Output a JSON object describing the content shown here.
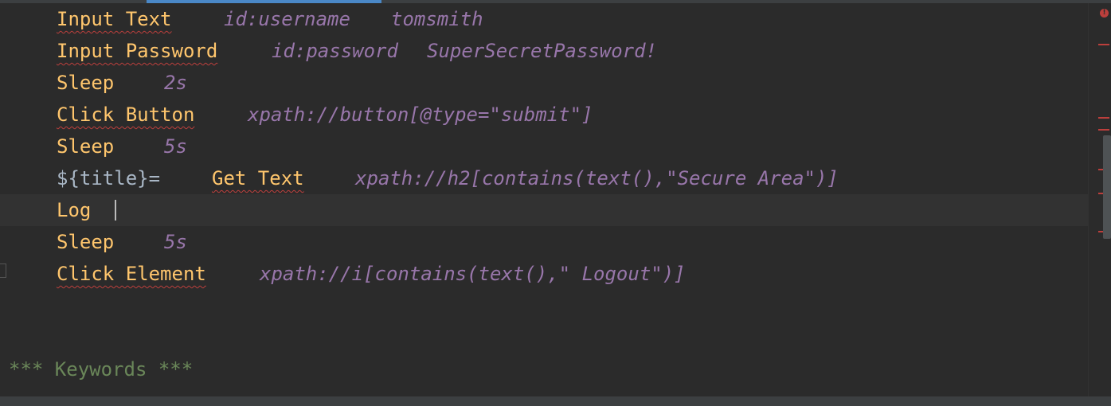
{
  "editor": {
    "lines": [
      {
        "keyword": "Input Text",
        "args": [
          "id:username",
          "tomsmith"
        ]
      },
      {
        "keyword": "Input Password",
        "args": [
          "id:password",
          "SuperSecretPassword!"
        ]
      },
      {
        "keyword": "Sleep",
        "args": [
          "2s"
        ]
      },
      {
        "keyword": "Click Button",
        "args": [
          "xpath://button[@type=\"submit\"]"
        ]
      },
      {
        "keyword": "Sleep",
        "args": [
          "5s"
        ]
      },
      {
        "variable": "${title}=",
        "keyword": "Get Text",
        "args": [
          "xpath://h2[contains(text(),\"Secure Area\")]"
        ]
      },
      {
        "keyword": "Log",
        "args": []
      },
      {
        "keyword": "Sleep",
        "args": [
          "5s"
        ]
      },
      {
        "keyword": "Click Element",
        "args": [
          "xpath://i[contains(text(),\" Logout\")]"
        ]
      }
    ],
    "section_header": "*** Keywords ***"
  },
  "icons": {
    "error_indicator": "error-icon",
    "fold_marker": "fold-marker-icon"
  },
  "colors": {
    "background": "#2b2b2b",
    "current_line": "#323232",
    "keyword": "#ffc66d",
    "argument": "#9876aa",
    "variable": "#a9b7c6",
    "section": "#6a8759",
    "error": "#bc3f3c",
    "tab_indicator": "#4a88c7"
  }
}
